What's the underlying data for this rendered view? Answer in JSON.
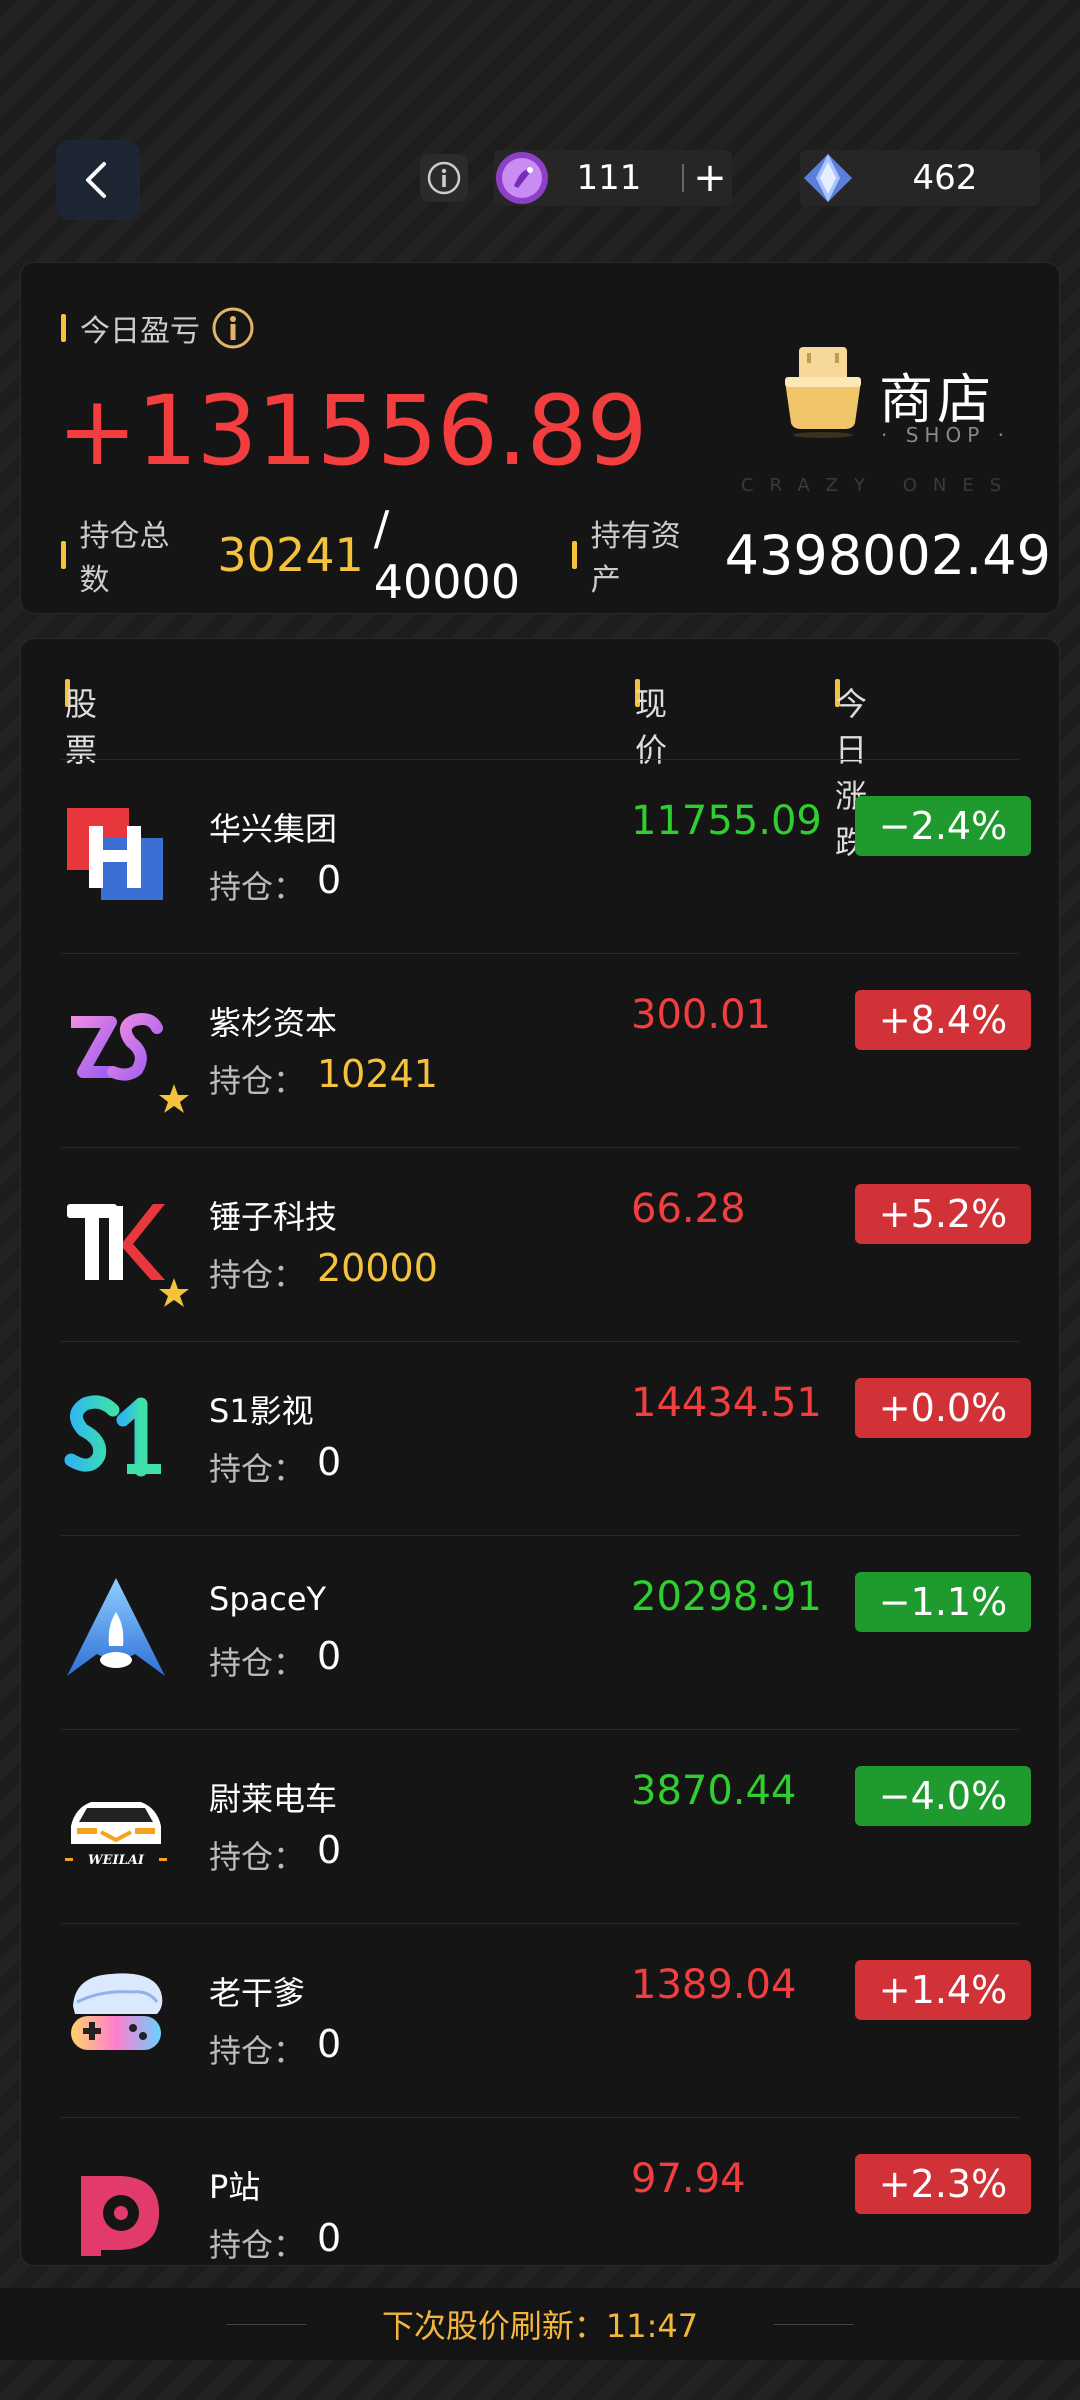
{
  "topbar": {
    "coin_value": "111",
    "gem_value": "462"
  },
  "summary": {
    "today_label": "今日盈亏",
    "pnl": "+131556.89",
    "shop_title": "商店",
    "shop_sub": "· SHOP ·",
    "shop_watermark": "CRAZY ONES",
    "holdings_label": "持仓总数",
    "holdings_held": "30241",
    "holdings_total": "/ 40000",
    "assets_label": "持有资产",
    "assets_value": "4398002.49"
  },
  "list": {
    "header_stock": "股票",
    "header_price": "现价",
    "header_change": "今日涨跌",
    "hold_label": "持仓：",
    "stocks": [
      {
        "name": "华兴集团",
        "hold": "0",
        "price": "11755.09",
        "change": "−2.4%",
        "dir": "down",
        "fav": false
      },
      {
        "name": "紫杉资本",
        "hold": "10241",
        "price": "300.01",
        "change": "+8.4%",
        "dir": "up",
        "fav": true
      },
      {
        "name": "锤子科技",
        "hold": "20000",
        "price": "66.28",
        "change": "+5.2%",
        "dir": "up",
        "fav": true
      },
      {
        "name": "S1影视",
        "hold": "0",
        "price": "14434.51",
        "change": "+0.0%",
        "dir": "up",
        "fav": false
      },
      {
        "name": "SpaceY",
        "hold": "0",
        "price": "20298.91",
        "change": "−1.1%",
        "dir": "down",
        "fav": false
      },
      {
        "name": "尉莱电车",
        "hold": "0",
        "price": "3870.44",
        "change": "−4.0%",
        "dir": "down",
        "fav": false
      },
      {
        "name": "老干爹",
        "hold": "0",
        "price": "1389.04",
        "change": "+1.4%",
        "dir": "up",
        "fav": false
      },
      {
        "name": "P站",
        "hold": "0",
        "price": "97.94",
        "change": "+2.3%",
        "dir": "up",
        "fav": false
      }
    ],
    "logo_texts": {
      "weilai": "WEILAI"
    }
  },
  "footer": {
    "refresh_text": "下次股价刷新：11:47"
  },
  "colors": {
    "accent_gold": "#f4c23c",
    "up_red": "#f23e3e",
    "down_green": "#2fcf2f"
  },
  "icons": [
    "back-arrow-icon",
    "info-icon",
    "coin-icon",
    "plus-icon",
    "diamond-icon",
    "shop-bag-icon",
    "star-icon"
  ]
}
